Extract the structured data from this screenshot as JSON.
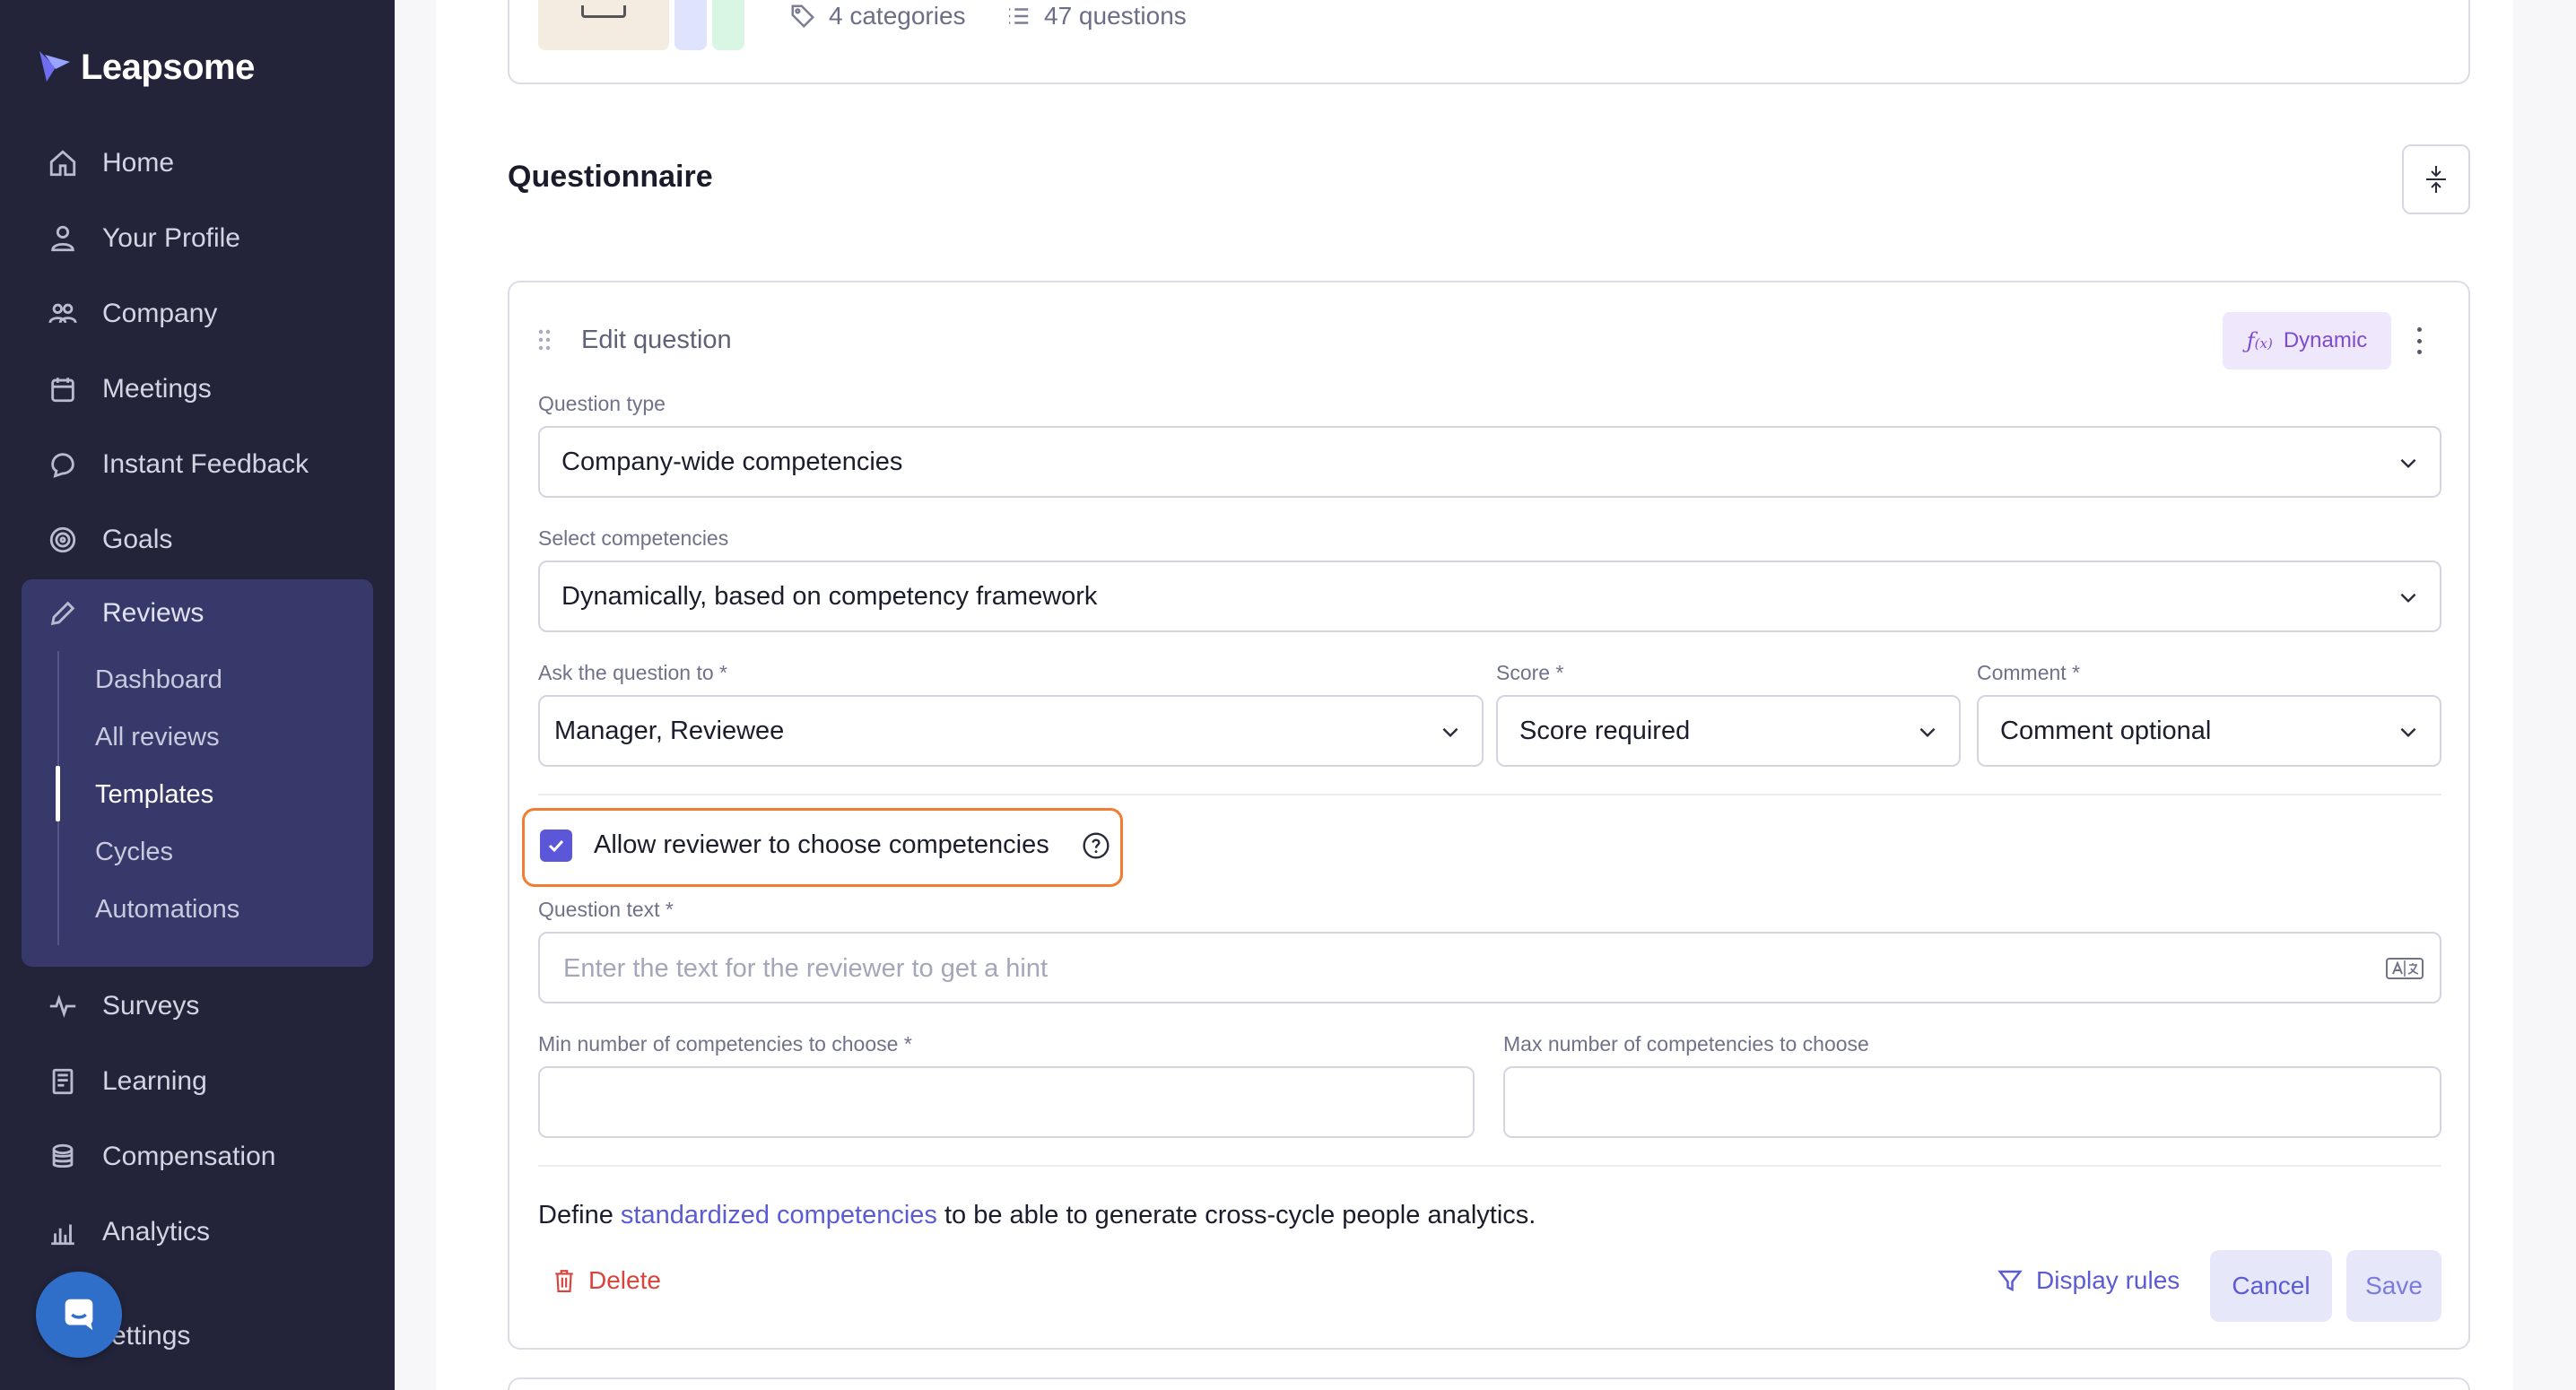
{
  "app": {
    "brand": "Leapsome"
  },
  "sidebar": {
    "items": [
      {
        "label": "Home",
        "icon": "home-icon"
      },
      {
        "label": "Your Profile",
        "icon": "user-icon"
      },
      {
        "label": "Company",
        "icon": "users-icon"
      },
      {
        "label": "Meetings",
        "icon": "calendar-icon"
      },
      {
        "label": "Instant Feedback",
        "icon": "chat-icon"
      },
      {
        "label": "Goals",
        "icon": "target-icon"
      },
      {
        "label": "Reviews",
        "icon": "pencil-icon"
      },
      {
        "label": "Surveys",
        "icon": "pulse-icon"
      },
      {
        "label": "Learning",
        "icon": "book-icon"
      },
      {
        "label": "Compensation",
        "icon": "coins-icon"
      },
      {
        "label": "Analytics",
        "icon": "bar-chart-icon"
      },
      {
        "label": "ettings",
        "icon": "gear-icon"
      }
    ],
    "reviews_sub": [
      {
        "label": "Dashboard"
      },
      {
        "label": "All reviews"
      },
      {
        "label": "Templates",
        "active": true
      },
      {
        "label": "Cycles"
      },
      {
        "label": "Automations"
      }
    ]
  },
  "header_card": {
    "categories": "4 categories",
    "questions": "47 questions",
    "thumb_colors": [
      "#f5ece1",
      "#dfe3fb",
      "#d9f5e4"
    ]
  },
  "main": {
    "section_title": "Questionnaire",
    "question": {
      "header": "Edit question",
      "dynamic_badge": "Dynamic",
      "question_type_label": "Question type",
      "question_type_value": "Company-wide competencies",
      "select_competencies_label": "Select competencies",
      "select_competencies_value": "Dynamically, based on competency framework",
      "ask_to_label": "Ask the question to *",
      "ask_to_value": "Manager, Reviewee",
      "score_label": "Score *",
      "score_value": "Score required",
      "comment_label": "Comment *",
      "comment_value": "Comment optional",
      "allow_choose_label": "Allow reviewer to choose competencies",
      "allow_choose_checked": true,
      "question_text_label": "Question text *",
      "question_text_placeholder": "Enter the text for the reviewer to get a hint",
      "min_label": "Min number of competencies to choose *",
      "max_label": "Max number of competencies to choose",
      "define_prefix": "Define",
      "define_link": "standardized competencies",
      "define_suffix": "to be able to generate cross-cycle people analytics.",
      "delete_label": "Delete",
      "display_rules_label": "Display rules",
      "cancel_label": "Cancel",
      "save_label": "Save"
    }
  },
  "colors": {
    "sidebar_bg": "#23243a",
    "sidebar_active_group": "#38396b",
    "accent": "#5c56d8",
    "highlight": "#f07d32",
    "danger": "#d9433b",
    "dynamic_badge_bg": "#efe7fb"
  }
}
